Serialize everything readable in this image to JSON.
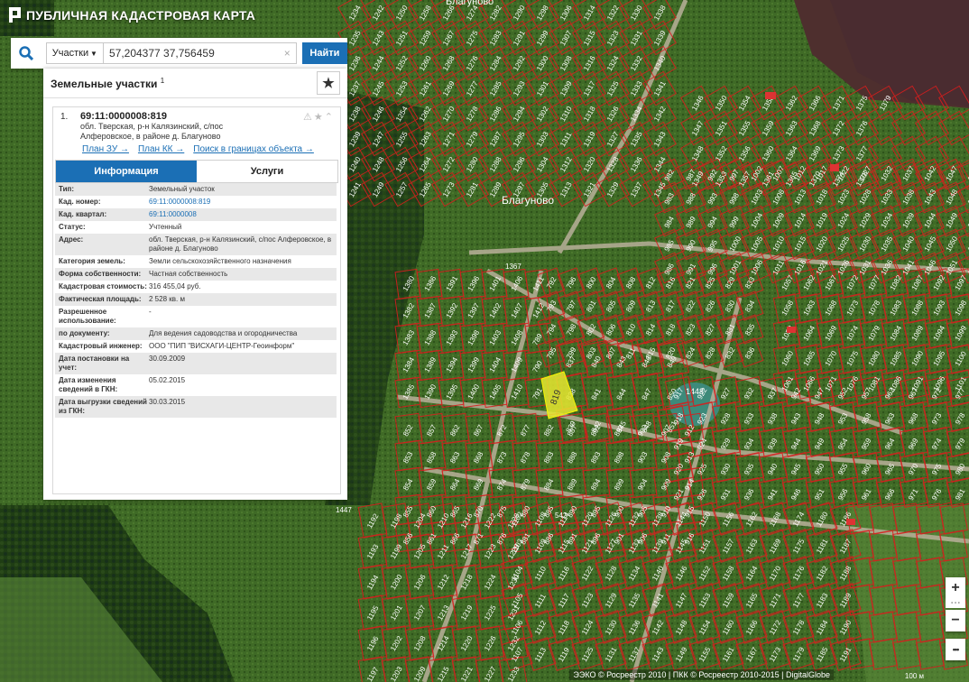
{
  "app": {
    "title": "ПУБЛИЧНАЯ КАДАСТРОВАЯ КАРТА"
  },
  "search": {
    "category": "Участки",
    "query": "57,204377 37,756459",
    "button": "Найти"
  },
  "panel": {
    "title": "Земельные участки",
    "count": "1"
  },
  "card": {
    "index": "1.",
    "cadastral_number": "69:11:0000008:819",
    "address_line1": "обл. Тверская, р-н Калязинский, с/пос",
    "address_line2": "Алферовское, в районе д. Благуново",
    "links": [
      "План ЗУ →",
      "План КК →",
      "Поиск в границах объекта →"
    ]
  },
  "tabs": {
    "info": "Информация",
    "services": "Услуги"
  },
  "attributes": [
    {
      "k": "Тип:",
      "v": "Земельный участок"
    },
    {
      "k": "Кад. номер:",
      "v": "69:11:0000008:819"
    },
    {
      "k": "Кад. квартал:",
      "v": "69:11:0000008"
    },
    {
      "k": "Статус:",
      "v": "Учтенный"
    },
    {
      "k": "Адрес:",
      "v": "обл. Тверская, р-н Калязинский, с/пос Алферовское, в районе д. Благуново"
    },
    {
      "k": "Категория земель:",
      "v": "Земли сельскохозяйственного назначения"
    },
    {
      "k": "Форма собственности:",
      "v": "Частная собственность"
    },
    {
      "k": "Кадастровая стоимость:",
      "v": "316 455,04 руб."
    },
    {
      "k": "Фактическая площадь:",
      "v": "2 528 кв. м"
    },
    {
      "k": "Разрешенное использование:",
      "v": "-"
    },
    {
      "k": "по документу:",
      "v": "Для ведения садоводства и огородничества"
    },
    {
      "k": "Кадастровый инженер:",
      "v": "ООО \"ПИП \"ВИСХАГИ-ЦЕНТР-Геоинформ\""
    },
    {
      "k": "Дата постановки на учет:",
      "v": "30.09.2009"
    },
    {
      "k": "Дата изменения сведений в ГКН:",
      "v": "05.02.2015"
    },
    {
      "k": "Дата выгрузки сведений из ГКН:",
      "v": "30.03.2015"
    }
  ],
  "map": {
    "village_label": "Благуново",
    "village_label_top": "Благуново",
    "pond_label": "1448",
    "highlight_label": "819",
    "road_labels": [
      "542",
      "1367",
      "1447"
    ],
    "parcel_labels": [
      "1380",
      "1382",
      "1383",
      "1384",
      "1385",
      "1386",
      "1387",
      "1388",
      "1389",
      "1390",
      "1391",
      "1392",
      "1393",
      "1394",
      "1395",
      "1396",
      "1397",
      "1398",
      "1399",
      "1400",
      "1401",
      "1402",
      "1403",
      "1404",
      "1405",
      "1406",
      "1407",
      "1408",
      "1409",
      "1410",
      "1411",
      "1412",
      "789",
      "790",
      "791",
      "792",
      "793",
      "794",
      "795",
      "796",
      "797",
      "798",
      "799",
      "800",
      "801",
      "802",
      "803",
      "804",
      "805",
      "806",
      "807",
      "808",
      "809",
      "810",
      "811",
      "812",
      "813",
      "814",
      "815",
      "816",
      "817",
      "818",
      "820",
      "821",
      "822",
      "823",
      "824",
      "825",
      "826",
      "827",
      "828",
      "829",
      "830",
      "831",
      "832",
      "833",
      "834",
      "835",
      "836",
      "837",
      "838",
      "839",
      "840",
      "841",
      "842",
      "843",
      "844",
      "845",
      "846",
      "847",
      "848",
      "849",
      "850",
      "851",
      "852",
      "853",
      "854",
      "855",
      "856",
      "857",
      "858",
      "859",
      "860",
      "861",
      "862",
      "863",
      "864",
      "865",
      "866",
      "867",
      "868",
      "869",
      "870",
      "871",
      "872",
      "873",
      "874",
      "875",
      "876",
      "877",
      "878",
      "879",
      "880",
      "881",
      "882",
      "883",
      "884",
      "885",
      "886",
      "887",
      "888",
      "889",
      "890",
      "891",
      "892",
      "893",
      "894",
      "895",
      "896",
      "897",
      "898",
      "899",
      "900",
      "901",
      "902",
      "903",
      "904",
      "905",
      "906",
      "907",
      "908",
      "909",
      "910",
      "911",
      "912",
      "913",
      "914",
      "915",
      "916",
      "917",
      "918",
      "919",
      "920",
      "921",
      "922",
      "923",
      "924",
      "925",
      "926",
      "927",
      "928",
      "929",
      "930",
      "931",
      "932",
      "933",
      "934",
      "935",
      "936",
      "937",
      "938",
      "939",
      "940",
      "941",
      "942",
      "943",
      "944",
      "945",
      "946",
      "947",
      "948",
      "949",
      "950",
      "951",
      "952",
      "953",
      "954",
      "955",
      "956",
      "957",
      "958",
      "959",
      "960",
      "961",
      "962",
      "963",
      "964",
      "965",
      "966",
      "967",
      "968",
      "969",
      "970",
      "971",
      "972",
      "973",
      "974",
      "975",
      "976",
      "977",
      "978",
      "979",
      "980",
      "981",
      "982",
      "983",
      "984",
      "985",
      "986",
      "987",
      "988",
      "989",
      "990",
      "991",
      "992",
      "993",
      "994",
      "995",
      "996",
      "997",
      "998",
      "999",
      "1000",
      "1001",
      "1002",
      "1003",
      "1004",
      "1005",
      "1006",
      "1007",
      "1008",
      "1009",
      "1010",
      "1011",
      "1012",
      "1013",
      "1014",
      "1015",
      "1016",
      "1017",
      "1018",
      "1019",
      "1020",
      "1021",
      "1022",
      "1023",
      "1024",
      "1025",
      "1026",
      "1027",
      "1028",
      "1029",
      "1030",
      "1031",
      "1032",
      "1033",
      "1034",
      "1035",
      "1036",
      "1037",
      "1038",
      "1039",
      "1040",
      "1041",
      "1042",
      "1043",
      "1044",
      "1045",
      "1046",
      "1047",
      "1048",
      "1049",
      "1050",
      "1051",
      "1052",
      "1053",
      "1054",
      "1055",
      "1056",
      "1057",
      "1058",
      "1059",
      "1060",
      "1061",
      "1062",
      "1063",
      "1064",
      "1065",
      "1066",
      "1067",
      "1068",
      "1069",
      "1070",
      "1071",
      "1072",
      "1073",
      "1074",
      "1075",
      "1076",
      "1077",
      "1078",
      "1079",
      "1080",
      "1081",
      "1082",
      "1083",
      "1084",
      "1085",
      "1086",
      "1087",
      "1088",
      "1089",
      "1090",
      "1091",
      "1092",
      "1093",
      "1094",
      "1095",
      "1096",
      "1097",
      "1098",
      "1099",
      "1100",
      "1101",
      "1102",
      "1103",
      "1104",
      "1105",
      "1106",
      "1107",
      "1108",
      "1109",
      "1110",
      "1111",
      "1112",
      "1113",
      "1114",
      "1115",
      "1116",
      "1117",
      "1118",
      "1119",
      "1120",
      "1121",
      "1122",
      "1123",
      "1124",
      "1125",
      "1126",
      "1127",
      "1128",
      "1129",
      "1130",
      "1131",
      "1132",
      "1133",
      "1134",
      "1135",
      "1136",
      "1137",
      "1138",
      "1139",
      "1140",
      "1141",
      "1142",
      "1143",
      "1144",
      "1145",
      "1146",
      "1147",
      "1148",
      "1149",
      "1150",
      "1151",
      "1152",
      "1153",
      "1154",
      "1155",
      "1156",
      "1157",
      "1158",
      "1159",
      "1160",
      "1161",
      "1162",
      "1163",
      "1164",
      "1165",
      "1166",
      "1167",
      "1168",
      "1169",
      "1170",
      "1171",
      "1172",
      "1173",
      "1174",
      "1175",
      "1176",
      "1177",
      "1178",
      "1179",
      "1180",
      "1181",
      "1182",
      "1183",
      "1184",
      "1185",
      "1186",
      "1187",
      "1188",
      "1189",
      "1190",
      "1191",
      "1192",
      "1193",
      "1194",
      "1195",
      "1196",
      "1197",
      "1198",
      "1199",
      "1200",
      "1201",
      "1202",
      "1203",
      "1204",
      "1205",
      "1206",
      "1207",
      "1208",
      "1209",
      "1210",
      "1211",
      "1212",
      "1213",
      "1214",
      "1215",
      "1216",
      "1217",
      "1218",
      "1219",
      "1220",
      "1221",
      "1222",
      "1223",
      "1224",
      "1225",
      "1226",
      "1227",
      "1228",
      "1229",
      "1230",
      "1231",
      "1232",
      "1233",
      "1234",
      "1235",
      "1236",
      "1237",
      "1238",
      "1239",
      "1240",
      "1241",
      "1242",
      "1243",
      "1244",
      "1245",
      "1246",
      "1247",
      "1248",
      "1249",
      "1250",
      "1251",
      "1252",
      "1253",
      "1254",
      "1255",
      "1256",
      "1257",
      "1258",
      "1259",
      "1260",
      "1261",
      "1262",
      "1263",
      "1264",
      "1265",
      "1266",
      "1267",
      "1268",
      "1269",
      "1270",
      "1271",
      "1272",
      "1273",
      "1274",
      "1275",
      "1276",
      "1277",
      "1278",
      "1279",
      "1280",
      "1281",
      "1282",
      "1283",
      "1284",
      "1285",
      "1286",
      "1287",
      "1288",
      "1289",
      "1290",
      "1291",
      "1292",
      "1293",
      "1294",
      "1295",
      "1296",
      "1297",
      "1298",
      "1299",
      "1300",
      "1301",
      "1302",
      "1303",
      "1304",
      "1305",
      "1306",
      "1307",
      "1308",
      "1309",
      "1310",
      "1311",
      "1312",
      "1313",
      "1314",
      "1315",
      "1316",
      "1317",
      "1318",
      "1319",
      "1320",
      "1321",
      "1322",
      "1323",
      "1324",
      "1325",
      "1326",
      "1327",
      "1328",
      "1329",
      "1330",
      "1331",
      "1332",
      "1333",
      "1334",
      "1335",
      "1336",
      "1337",
      "1338",
      "1339",
      "1340",
      "1341",
      "1342",
      "1343",
      "1344",
      "1345",
      "1346",
      "1347",
      "1348",
      "1349",
      "1350",
      "1351",
      "1352",
      "1353",
      "1354",
      "1355",
      "1356",
      "1357",
      "1358",
      "1359",
      "1360",
      "1361",
      "1362",
      "1363",
      "1364",
      "1365",
      "1366",
      "1368",
      "1369",
      "1370",
      "1371",
      "1372",
      "1373",
      "1374",
      "1375",
      "1376",
      "1377",
      "1378",
      "1379"
    ]
  },
  "controls": {
    "zoom_in": "+",
    "zoom_out": "−",
    "more": "•••"
  },
  "attribution": "ЭЭКО © Росреестр 2010 | ПКК © Росреестр 2010-2015 | DigitalGlobe",
  "scale": "100 м",
  "colors": {
    "accent": "#1b6fb5",
    "parcel": "#d81e1e",
    "highlight": "#e8e830",
    "pond": "#3d8a7a"
  }
}
